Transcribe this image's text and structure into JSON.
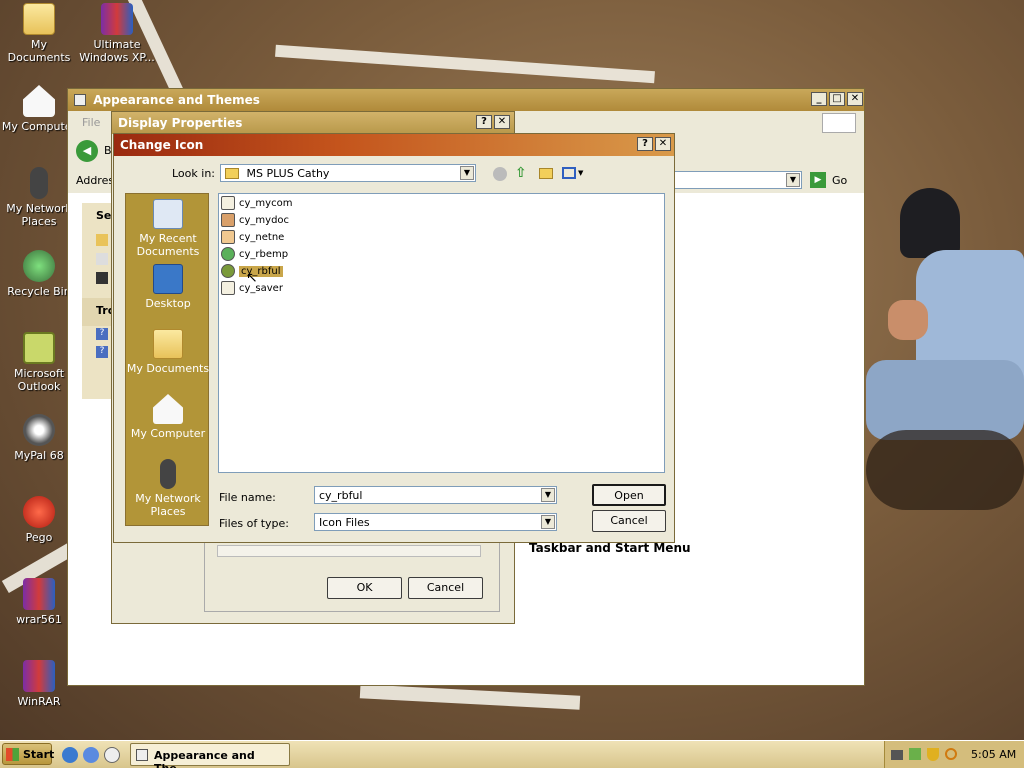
{
  "desktop": {
    "icons": [
      {
        "label": "My Documents",
        "icon": "folder-documents-icon"
      },
      {
        "label": "Ultimate Windows XP...",
        "icon": "winrar-icon"
      },
      {
        "label": "My Computer",
        "icon": "computer-icon"
      },
      {
        "label": "My Network Places",
        "icon": "network-mic-icon"
      },
      {
        "label": "Recycle Bin",
        "icon": "recycle-bin-icon"
      },
      {
        "label": "Microsoft Outlook",
        "icon": "outlook-icon"
      },
      {
        "label": "MyPal 68",
        "icon": "mypal-icon"
      },
      {
        "label": "Pego",
        "icon": "pego-icon"
      },
      {
        "label": "wrar561",
        "icon": "winrar-icon"
      },
      {
        "label": "WinRAR",
        "icon": "winrar-icon"
      }
    ]
  },
  "appearance": {
    "title": "Appearance and Themes",
    "menu_file": "File",
    "back_label": "B",
    "address_label": "Addres",
    "go_label": "Go",
    "side_see": "Se",
    "side_tro": "Tro",
    "taskbar_link": "Taskbar and Start Menu"
  },
  "display": {
    "title": "Display Properties",
    "ok": "OK",
    "cancel": "Cancel"
  },
  "change_icon": {
    "title": "Change Icon",
    "look_in_label": "Look in:",
    "look_in_value": "MS PLUS Cathy",
    "places": [
      "My Recent Documents",
      "Desktop",
      "My Documents",
      "My Computer",
      "My Network Places"
    ],
    "files": [
      "cy_mycom",
      "cy_mydoc",
      "cy_netne",
      "cy_rbemp",
      "cy_rbful",
      "cy_saver"
    ],
    "selected_file": "cy_rbful",
    "file_name_label": "File name:",
    "file_name_value": "cy_rbful",
    "files_of_type_label": "Files of type:",
    "files_of_type_value": "Icon Files",
    "open": "Open",
    "cancel": "Cancel"
  },
  "taskbar": {
    "start": "Start",
    "task_label": "Appearance and The...",
    "clock": "5:05 AM"
  },
  "colors": {
    "titlebar": "#b08a3a",
    "places_bg": "#b29538",
    "selection": "#c9a64a"
  }
}
